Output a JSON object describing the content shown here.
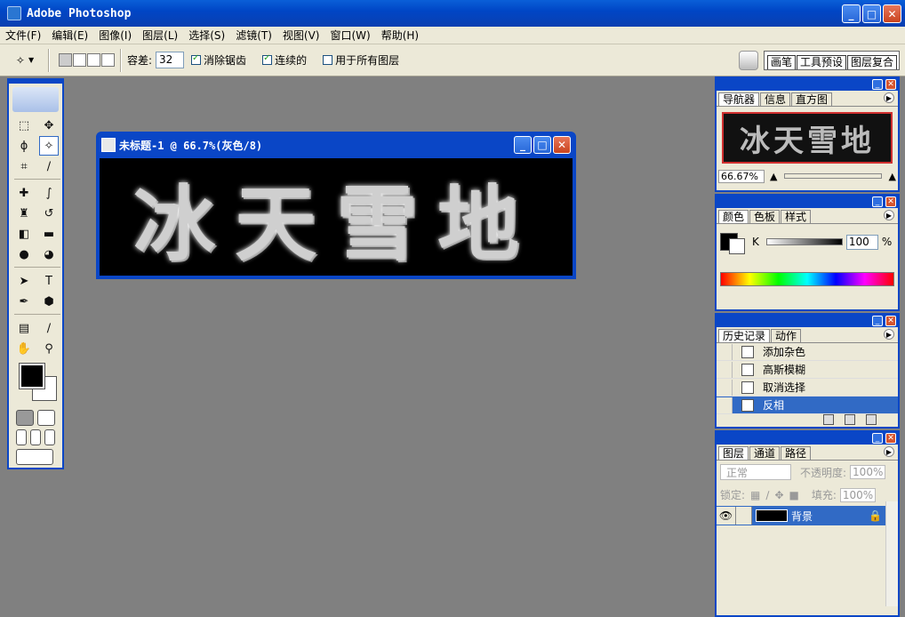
{
  "app": {
    "title": "Adobe Photoshop"
  },
  "menu": [
    "文件(F)",
    "编辑(E)",
    "图像(I)",
    "图层(L)",
    "选择(S)",
    "滤镜(T)",
    "视图(V)",
    "窗口(W)",
    "帮助(H)"
  ],
  "options": {
    "tolerance_label": "容差:",
    "tolerance_value": "32",
    "antialias_label": "消除锯齿",
    "contiguous_label": "连续的",
    "all_layers_label": "用于所有图层"
  },
  "palette_well": [
    "画笔",
    "工具预设",
    "图层复合"
  ],
  "document": {
    "title": "未标题-1 @ 66.7%(灰色/8)",
    "canvas_text": "冰天雪地"
  },
  "navigator": {
    "tabs": [
      "导航器",
      "信息",
      "直方图"
    ],
    "zoom": "66.67%",
    "thumb_text": "冰天雪地"
  },
  "color": {
    "tabs": [
      "颜色",
      "色板",
      "样式"
    ],
    "channel": "K",
    "value": "100",
    "unit": "%"
  },
  "history": {
    "tabs": [
      "历史记录",
      "动作"
    ],
    "items": [
      "添加杂色",
      "高斯模糊",
      "取消选择",
      "反相"
    ]
  },
  "layers": {
    "tabs": [
      "图层",
      "通道",
      "路径"
    ],
    "blend_mode": "正常",
    "opacity_label": "不透明度:",
    "opacity_value": "100%",
    "lock_label": "锁定:",
    "fill_label": "填充:",
    "fill_value": "100%",
    "layer_name": "背景"
  }
}
